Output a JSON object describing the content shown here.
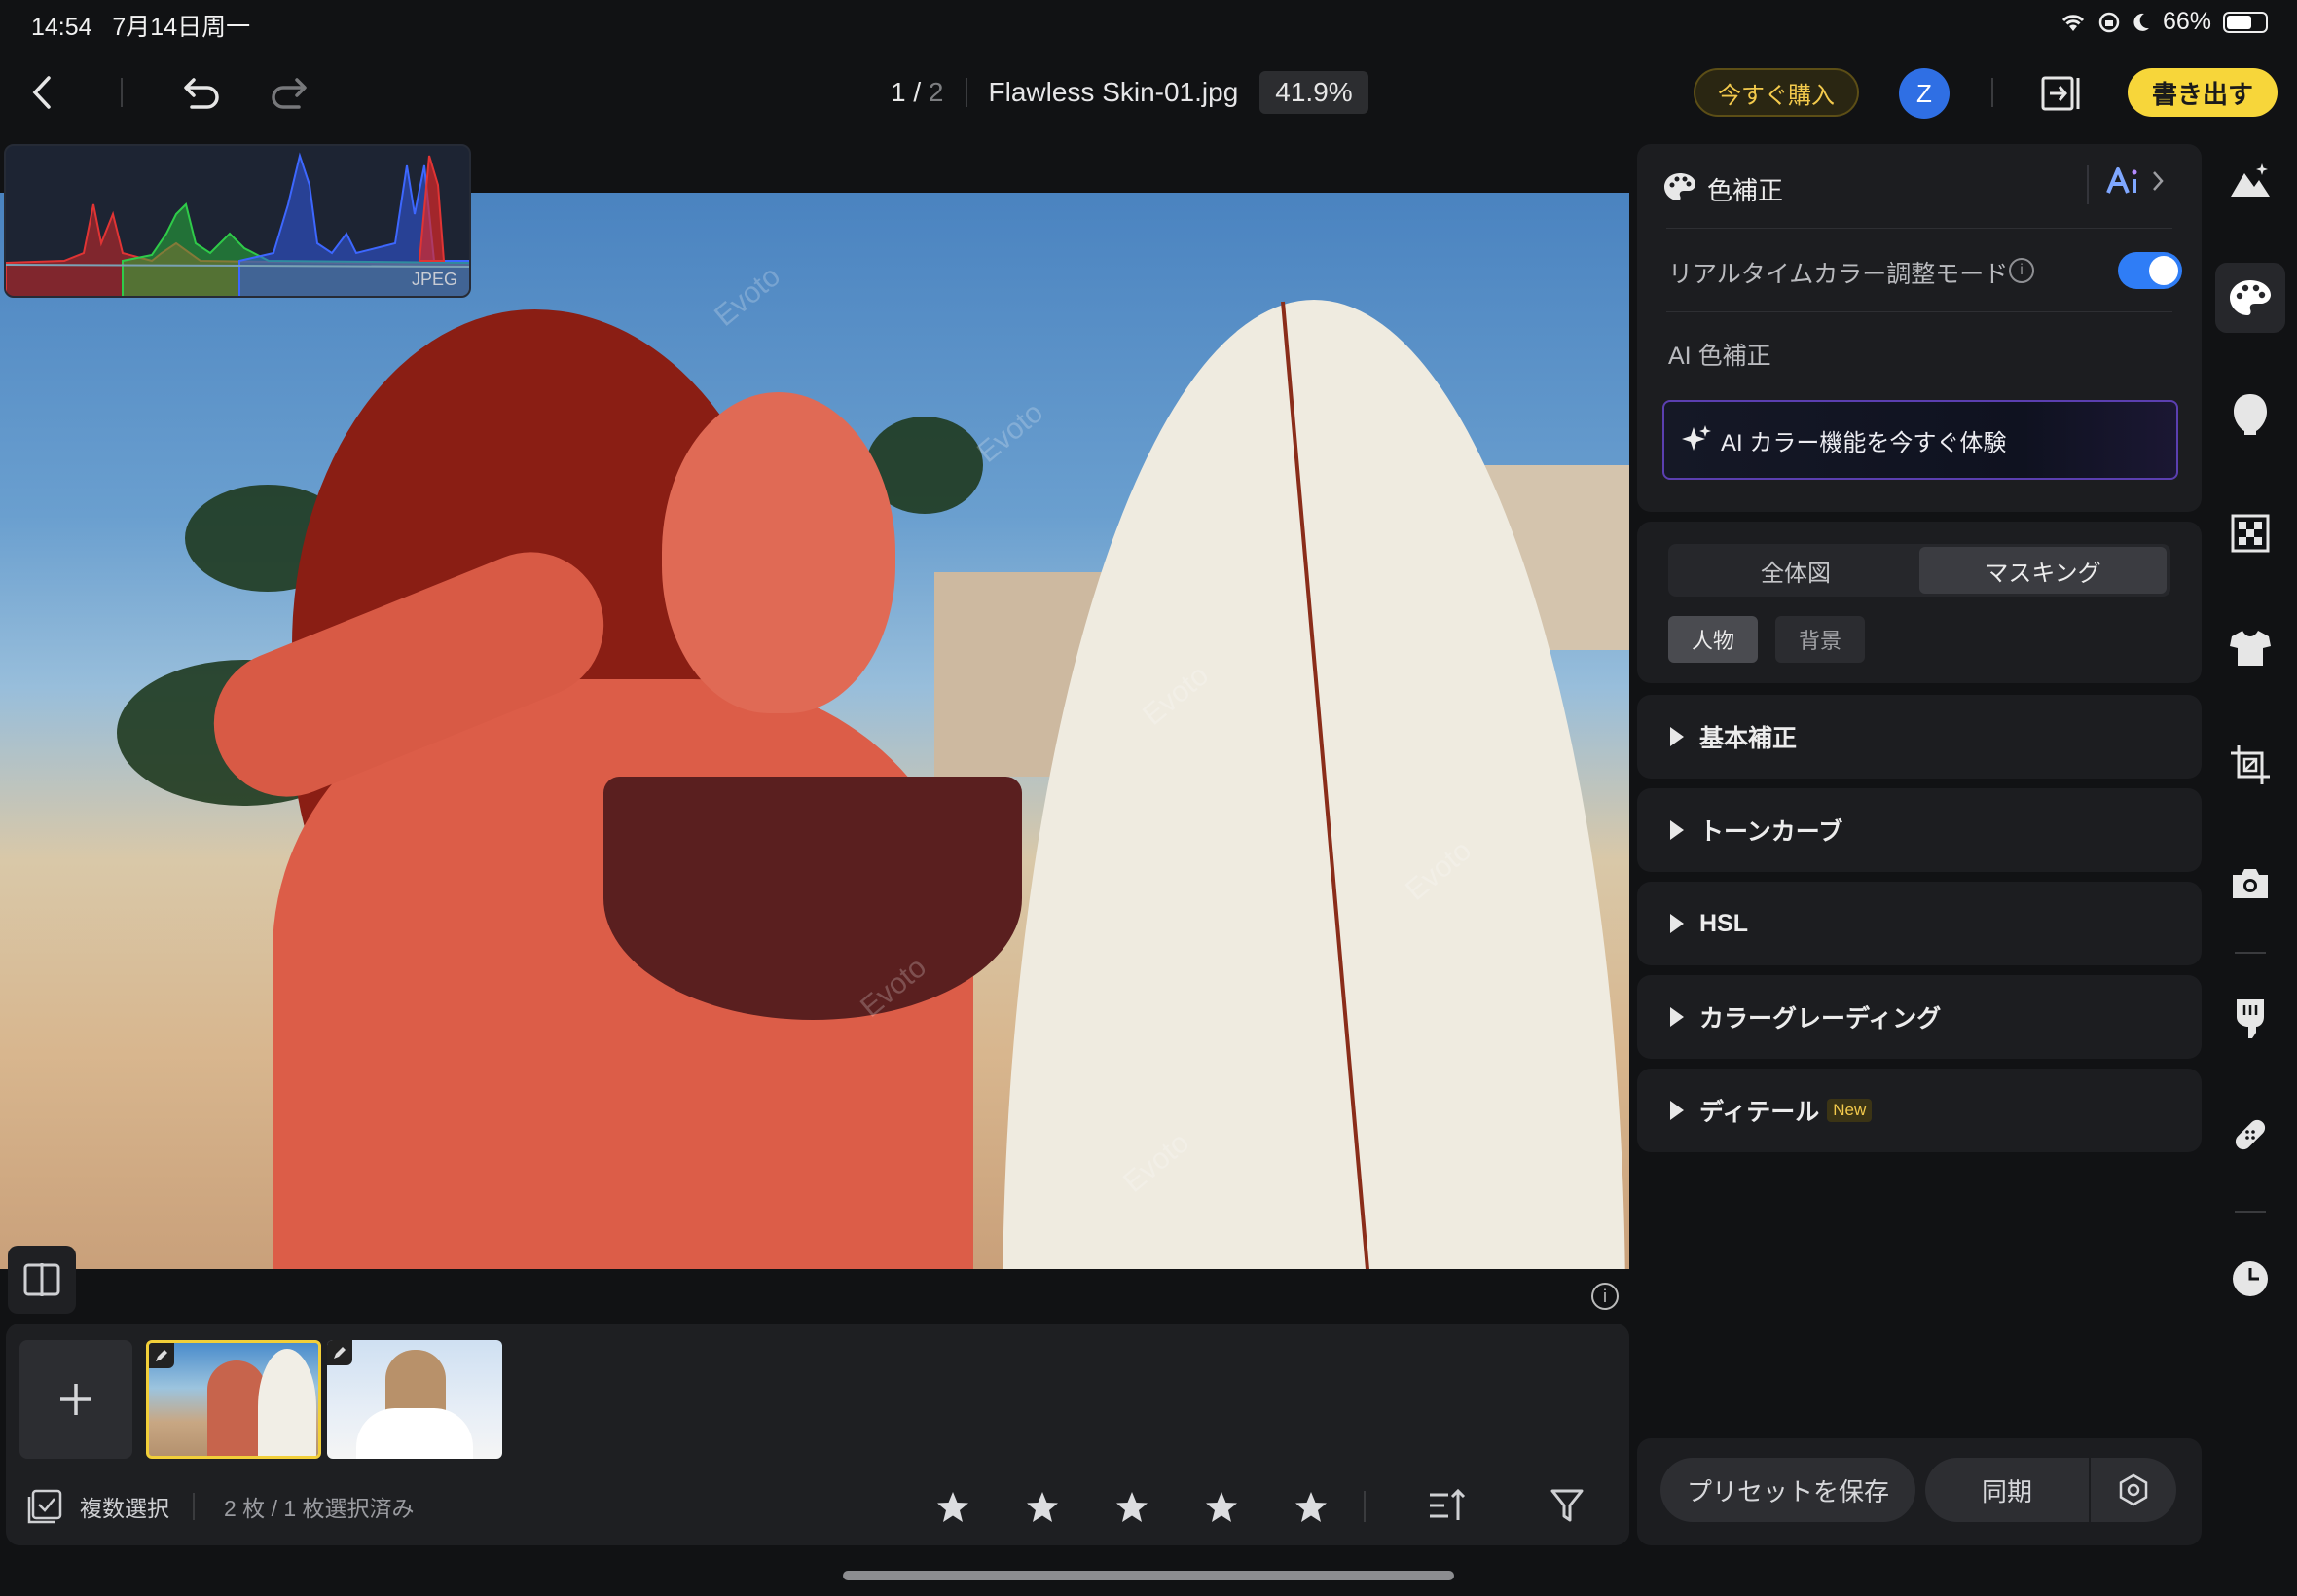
{
  "status": {
    "time": "14:54",
    "date": "7月14日周一",
    "battery": "66%",
    "battery_level": 0.66
  },
  "header": {
    "page_current": "1",
    "page_sep": "/",
    "page_total": "2",
    "filename": "Flawless Skin-01.jpg",
    "zoom": "41.9%",
    "buy_label": "今すぐ購入",
    "avatar_letter": "Z",
    "export_label": "書き出す"
  },
  "histogram": {
    "label": "JPEG"
  },
  "canvas": {
    "watermark": "Evoto"
  },
  "filmstrip": {
    "multi_select_label": "複数選択",
    "selection_count": "2 枚 / 1 枚選択済み",
    "rating_stars": 5
  },
  "panel": {
    "title": "色補正",
    "realtime_label": "リアルタイムカラー調整モード",
    "realtime_on": true,
    "ai_section_label": "AI 色補正",
    "ai_button_label": "AI カラー機能を今すぐ体験",
    "segments": [
      "全体図",
      "マスキング"
    ],
    "active_segment": "マスキング",
    "chips": [
      "人物",
      "背景"
    ],
    "active_chip": "人物",
    "sections": [
      {
        "label": "基本補正"
      },
      {
        "label": "トーンカーブ"
      },
      {
        "label": "HSL"
      },
      {
        "label": "カラーグレーディング"
      },
      {
        "label": "ディテール",
        "badge": "New"
      }
    ],
    "save_preset_label": "プリセットを保存",
    "sync_label": "同期"
  },
  "rail": [
    "landscape-icon",
    "palette-icon",
    "face-icon",
    "checker-icon",
    "shirt-icon",
    "crop-icon",
    "camera-icon",
    "hand-icon",
    "bandage-icon",
    "history-icon"
  ],
  "colors": {
    "accent_yellow": "#f7d63a",
    "toggle_blue": "#2f7df6",
    "avatar_blue": "#2f6fe4",
    "selected_thumb": "#f2cf39"
  }
}
